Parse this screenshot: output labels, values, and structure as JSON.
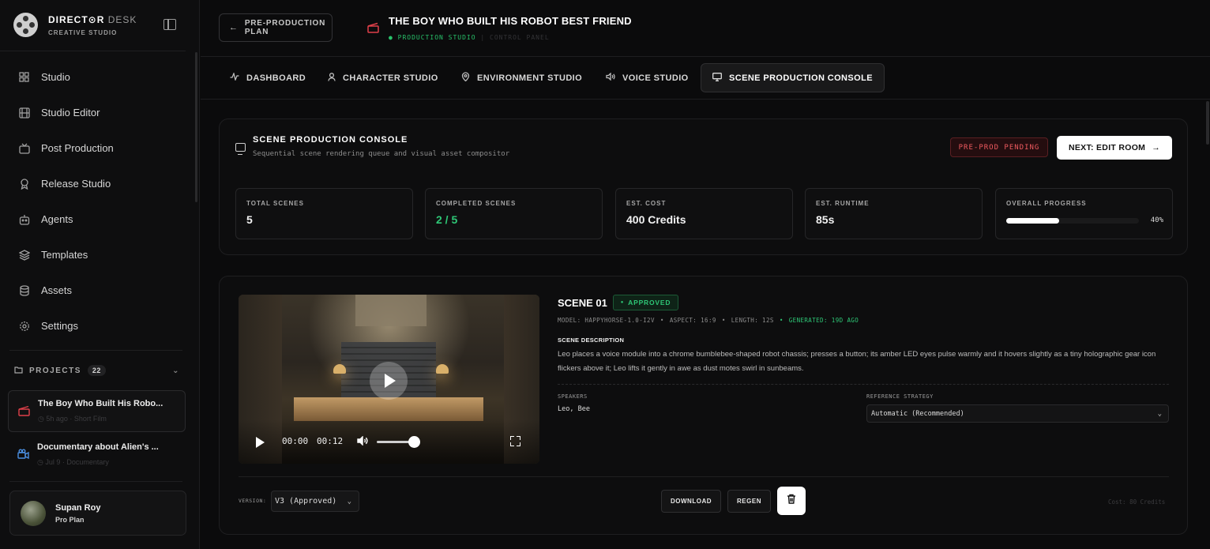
{
  "brand": {
    "name_bold": "DIRECT⊙R",
    "name_thin": "DESK",
    "subtitle": "CREATIVE STUDIO"
  },
  "nav": [
    {
      "label": "Studio",
      "icon": "grid-icon"
    },
    {
      "label": "Studio Editor",
      "icon": "film-icon"
    },
    {
      "label": "Post Production",
      "icon": "tv-icon"
    },
    {
      "label": "Release Studio",
      "icon": "award-icon"
    },
    {
      "label": "Agents",
      "icon": "bot-icon"
    },
    {
      "label": "Templates",
      "icon": "layers-icon"
    },
    {
      "label": "Assets",
      "icon": "database-icon"
    },
    {
      "label": "Settings",
      "icon": "gear-icon"
    }
  ],
  "projects": {
    "heading": "PROJECTS",
    "count": "22",
    "items": [
      {
        "title": "The Boy Who Built His Robo...",
        "meta": "◷ 5h ago · Short Film",
        "icon": "clapperboard-icon",
        "icon_color": "#e0404a"
      },
      {
        "title": "Documentary about Alien's ...",
        "meta": "◷ Jul 9 · Documentary",
        "icon": "camera-icon",
        "icon_color": "#4a8ee0"
      }
    ]
  },
  "user": {
    "name": "Supan Roy",
    "plan": "Pro Plan"
  },
  "header": {
    "back_label": "PRE-PRODUCTION PLAN",
    "title": "THE BOY WHO BUILT HIS ROBOT BEST FRIEND",
    "status": "PRODUCTION STUDIO",
    "panel": "CONTROL PANEL"
  },
  "tabs": [
    {
      "label": "DASHBOARD",
      "icon": "activity-icon"
    },
    {
      "label": "CHARACTER STUDIO",
      "icon": "user-icon"
    },
    {
      "label": "ENVIRONMENT STUDIO",
      "icon": "map-pin-icon"
    },
    {
      "label": "VOICE STUDIO",
      "icon": "speaker-icon"
    },
    {
      "label": "SCENE PRODUCTION CONSOLE",
      "icon": "monitor-icon",
      "active": true
    }
  ],
  "console": {
    "title": "SCENE PRODUCTION CONSOLE",
    "subtitle": "Sequential scene rendering queue and visual asset compositor",
    "badge": "PRE-PROD PENDING",
    "next_label": "NEXT: EDIT ROOM",
    "stats": [
      {
        "label": "TOTAL SCENES",
        "value": "5"
      },
      {
        "label": "COMPLETED SCENES",
        "value": "2 / 5"
      },
      {
        "label": "EST. COST",
        "value": "400 Credits"
      },
      {
        "label": "EST. RUNTIME",
        "value": "85s"
      },
      {
        "label": "OVERALL PROGRESS",
        "value": "40%",
        "progress": 0.4
      }
    ]
  },
  "scene": {
    "title": "SCENE 01",
    "status": "APPROVED",
    "model": "MODEL: HAPPYHORSE-1.0-I2V",
    "aspect": "ASPECT: 16:9",
    "length": "LENGTH: 12S",
    "generated": "GENERATED: 19D AGO",
    "desc_heading": "SCENE DESCRIPTION",
    "description": "Leo places a voice module into a chrome bumblebee-shaped robot chassis; presses a button; its amber LED eyes pulse warmly and it hovers slightly as a tiny holographic gear icon flickers above it; Leo lifts it gently in awe as dust motes swirl in sunbeams.",
    "speakers_label": "SPEAKERS",
    "speakers": "Leo, Bee",
    "ref_label": "REFERENCE STRATEGY",
    "ref_value": "Automatic (Recommended)",
    "video": {
      "current_time": "00:00",
      "duration": "00:12",
      "volume": 1.0
    },
    "version_label": "VERSION:",
    "version_value": "V3 (Approved)",
    "download_label": "DOWNLOAD",
    "regen_label": "REGEN",
    "cost": "Cost: 80 Credits"
  }
}
